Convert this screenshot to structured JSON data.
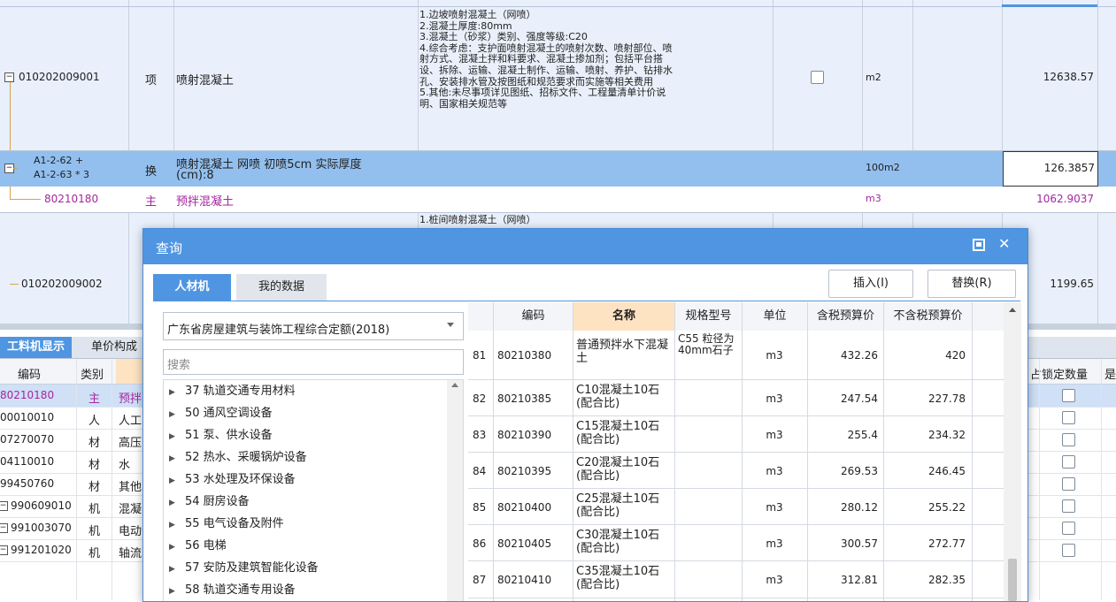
{
  "upper_grid": {
    "rows": [
      {
        "code": "010202009001",
        "type": "项",
        "name": "喷射混凝土",
        "desc_lines": [
          "1.边坡喷射混凝土（网喷）",
          "2.混凝土厚度:80mm",
          "3.混凝土（砂浆）类别、强度等级:C20",
          "4.综合考虑：支护面喷射混凝土的喷射次数、喷射部位、喷",
          "射方式、混凝土拌和料要求、混凝土掺加剂；包括平台搭",
          "设、拆除、运输、混凝土制作、运输、喷射、养护、钻排水",
          "孔、安装排水管及按图纸和规范要求而实施等相关费用",
          "5.其他:未尽事项详见图纸、招标文件、工程量清单计价说",
          "明、国家相关规范等"
        ],
        "unit": "m2",
        "qty": "12638.57"
      },
      {
        "code_line1": "A1-2-62 +",
        "code_line2": "A1-2-63 * 3",
        "type": "换",
        "name_line1": "喷射混凝土 网喷 初喷5cm  实际厚度",
        "name_line2": "(cm):8",
        "unit": "100m2",
        "qty": "126.3857"
      },
      {
        "code": "80210180",
        "type": "主",
        "name": "预拌混凝土",
        "unit": "m3",
        "qty": "1062.9037"
      },
      {
        "code": "010202009002",
        "desc_line": "1.桩间喷射混凝土（网喷）",
        "qty": "1199.65"
      }
    ]
  },
  "lower_panel": {
    "tabs": [
      "工料机显示",
      "单价构成"
    ],
    "headers": {
      "code": "编码",
      "type": "类别",
      "lock_qty": "锁定数量",
      "more": "是",
      "frag": "占"
    },
    "rows": [
      {
        "code": "80210180",
        "type": "主",
        "name": "预拌"
      },
      {
        "code": "00010010",
        "type": "人",
        "name": "人工"
      },
      {
        "code": "07270070",
        "type": "材",
        "name": "高压"
      },
      {
        "code": "04110010",
        "type": "材",
        "name": "水"
      },
      {
        "code": "99450760",
        "type": "材",
        "name": "其他"
      },
      {
        "code": "990609010",
        "type": "机",
        "name": "混凝"
      },
      {
        "code": "991003070",
        "type": "机",
        "name": "电动"
      },
      {
        "code": "991201020",
        "type": "机",
        "name": "轴流"
      }
    ]
  },
  "dialog": {
    "title": "查询",
    "tabs": {
      "material": "人材机",
      "my_data": "我的数据"
    },
    "buttons": {
      "insert": "插入(I)",
      "replace": "替换(R)"
    },
    "quota_select": "广东省房屋建筑与装饰工程综合定额(2018)",
    "search_placeholder": "搜索",
    "tree_items": [
      "37 轨道交通专用材料",
      "50 通风空调设备",
      "51 泵、供水设备",
      "52 热水、采暖锅炉设备",
      "53 水处理及环保设备",
      "54 厨房设备",
      "55 电气设备及附件",
      "56 电梯",
      "57 安防及建筑智能化设备",
      "58 轨道交通专用设备"
    ],
    "table": {
      "headers": {
        "code": "编码",
        "name": "名称",
        "spec": "规格型号",
        "unit": "单位",
        "price_tax": "含税预算价",
        "price_notax": "不含税预算价"
      },
      "rows": [
        {
          "no": "81",
          "code": "80210380",
          "name": "普通预拌水下混凝土",
          "spec": "C55 粒径为40mm石子",
          "unit": "m3",
          "price_tax": "432.26",
          "price_notax": "420"
        },
        {
          "no": "82",
          "code": "80210385",
          "name": "C10混凝土10石(配合比)",
          "spec": "",
          "unit": "m3",
          "price_tax": "247.54",
          "price_notax": "227.78"
        },
        {
          "no": "83",
          "code": "80210390",
          "name": "C15混凝土10石(配合比)",
          "spec": "",
          "unit": "m3",
          "price_tax": "255.4",
          "price_notax": "234.32"
        },
        {
          "no": "84",
          "code": "80210395",
          "name": "C20混凝土10石(配合比)",
          "spec": "",
          "unit": "m3",
          "price_tax": "269.53",
          "price_notax": "246.45"
        },
        {
          "no": "85",
          "code": "80210400",
          "name": "C25混凝土10石(配合比)",
          "spec": "",
          "unit": "m3",
          "price_tax": "280.12",
          "price_notax": "255.22"
        },
        {
          "no": "86",
          "code": "80210405",
          "name": "C30混凝土10石(配合比)",
          "spec": "",
          "unit": "m3",
          "price_tax": "300.57",
          "price_notax": "272.77"
        },
        {
          "no": "87",
          "code": "80210410",
          "name": "C35混凝土10石(配合比)",
          "spec": "",
          "unit": "m3",
          "price_tax": "312.81",
          "price_notax": "282.35"
        }
      ]
    }
  }
}
